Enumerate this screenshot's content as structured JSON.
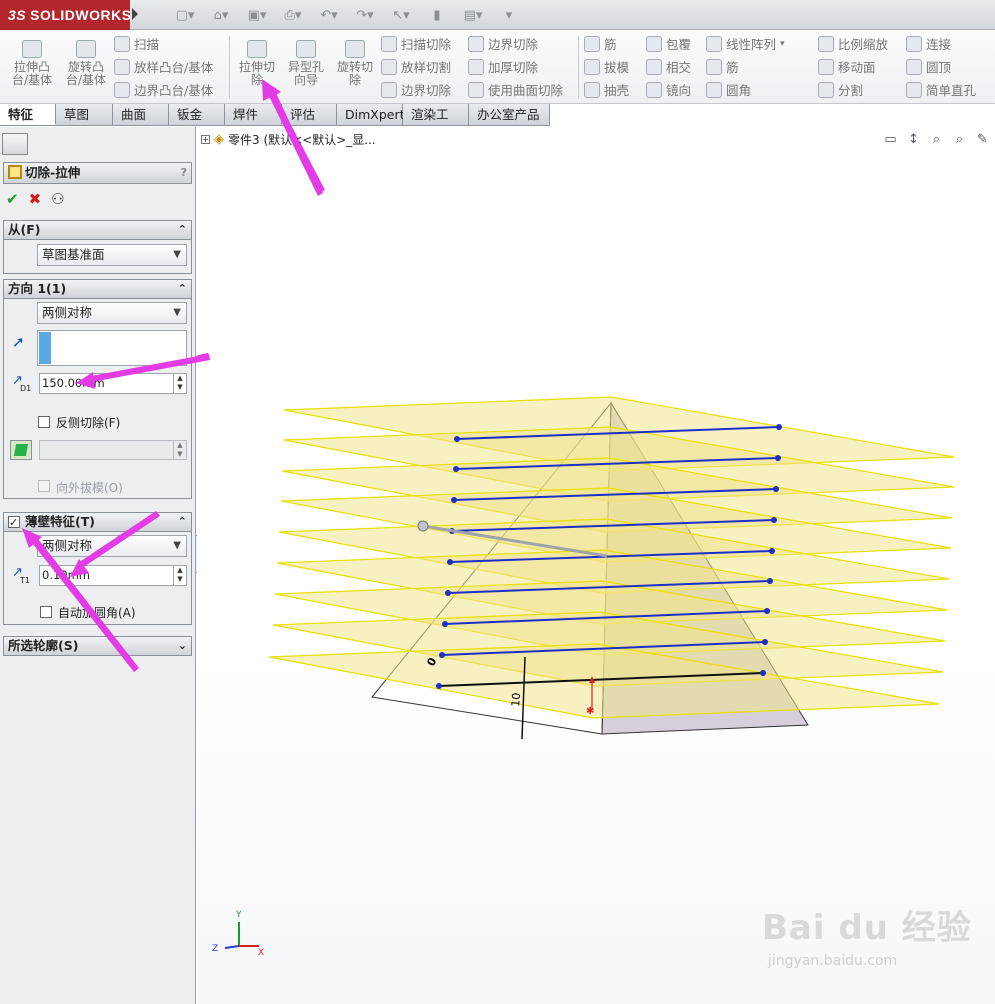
{
  "app": {
    "logo": "SOLIDWORKS",
    "logo_mark": "3S"
  },
  "quick_icons": [
    "new-icon",
    "open-icon",
    "save-icon",
    "print-icon",
    "undo-icon",
    "redo-icon",
    "select-icon",
    "rebuild-icon",
    "options-icon",
    "customize-icon"
  ],
  "ribbon": {
    "big": [
      {
        "label": "拉伸凸\n台/基体",
        "name": "extruded-boss-button"
      },
      {
        "label": "旋转凸\n台/基体",
        "name": "revolved-boss-button"
      },
      {
        "label": "拉伸切\n除",
        "name": "extruded-cut-button"
      },
      {
        "label": "异型孔\n向导",
        "name": "hole-wizard-button"
      },
      {
        "label": "旋转切\n除",
        "name": "revolved-cut-button"
      }
    ],
    "group1": [
      "扫描",
      "放样凸台/基体",
      "边界凸台/基体"
    ],
    "group2": [
      "扫描切除",
      "放样切割",
      "边界切除"
    ],
    "group3": [
      "边界切除",
      "加厚切除",
      "使用曲面切除"
    ],
    "group4": [
      "筋",
      "拔模",
      "抽壳"
    ],
    "group5": [
      "包覆",
      "相交",
      "镜向"
    ],
    "group6": [
      "线性阵列",
      "筋",
      "圆角"
    ],
    "group7": [
      "比例缩放",
      "移动面",
      "分割"
    ],
    "group8": [
      "连接",
      "圆顶",
      "简单直孔"
    ]
  },
  "tabs": [
    "特征",
    "草图",
    "曲面",
    "钣金",
    "焊件",
    "评估",
    "DimXpert",
    "渲染工具",
    "办公室产品"
  ],
  "pm": {
    "title": "切除-拉伸",
    "help": "?",
    "from": {
      "header": "从(F)",
      "value": "草图基准面"
    },
    "dir1": {
      "header": "方向 1(1)",
      "type": "两侧对称",
      "depth_label": "D1",
      "depth": "150.00mm",
      "flip_label": "反侧切除(F)",
      "draft_label": "向外拔模(O)"
    },
    "thin": {
      "header": "薄壁特征(T)",
      "type": "两侧对称",
      "thick_label": "T1",
      "thickness": "0.10mm",
      "fillet_label": "自动加圆角(A)"
    },
    "contours": {
      "header": "所选轮廓(S)"
    }
  },
  "tree": {
    "label": "零件3 (默认<<默认>_显..."
  },
  "scene": {
    "dim_label_0": "0",
    "dim_label_10": "10",
    "axis_y": "Y",
    "axis_x": "X",
    "axis_z": "Z"
  },
  "watermark": {
    "main": "Bai du 经验",
    "sub": "jingyan.baidu.com"
  },
  "colors": {
    "accent": "#e33be6",
    "plane": "#f2e7a0",
    "sketch": "#1d2fc6"
  }
}
